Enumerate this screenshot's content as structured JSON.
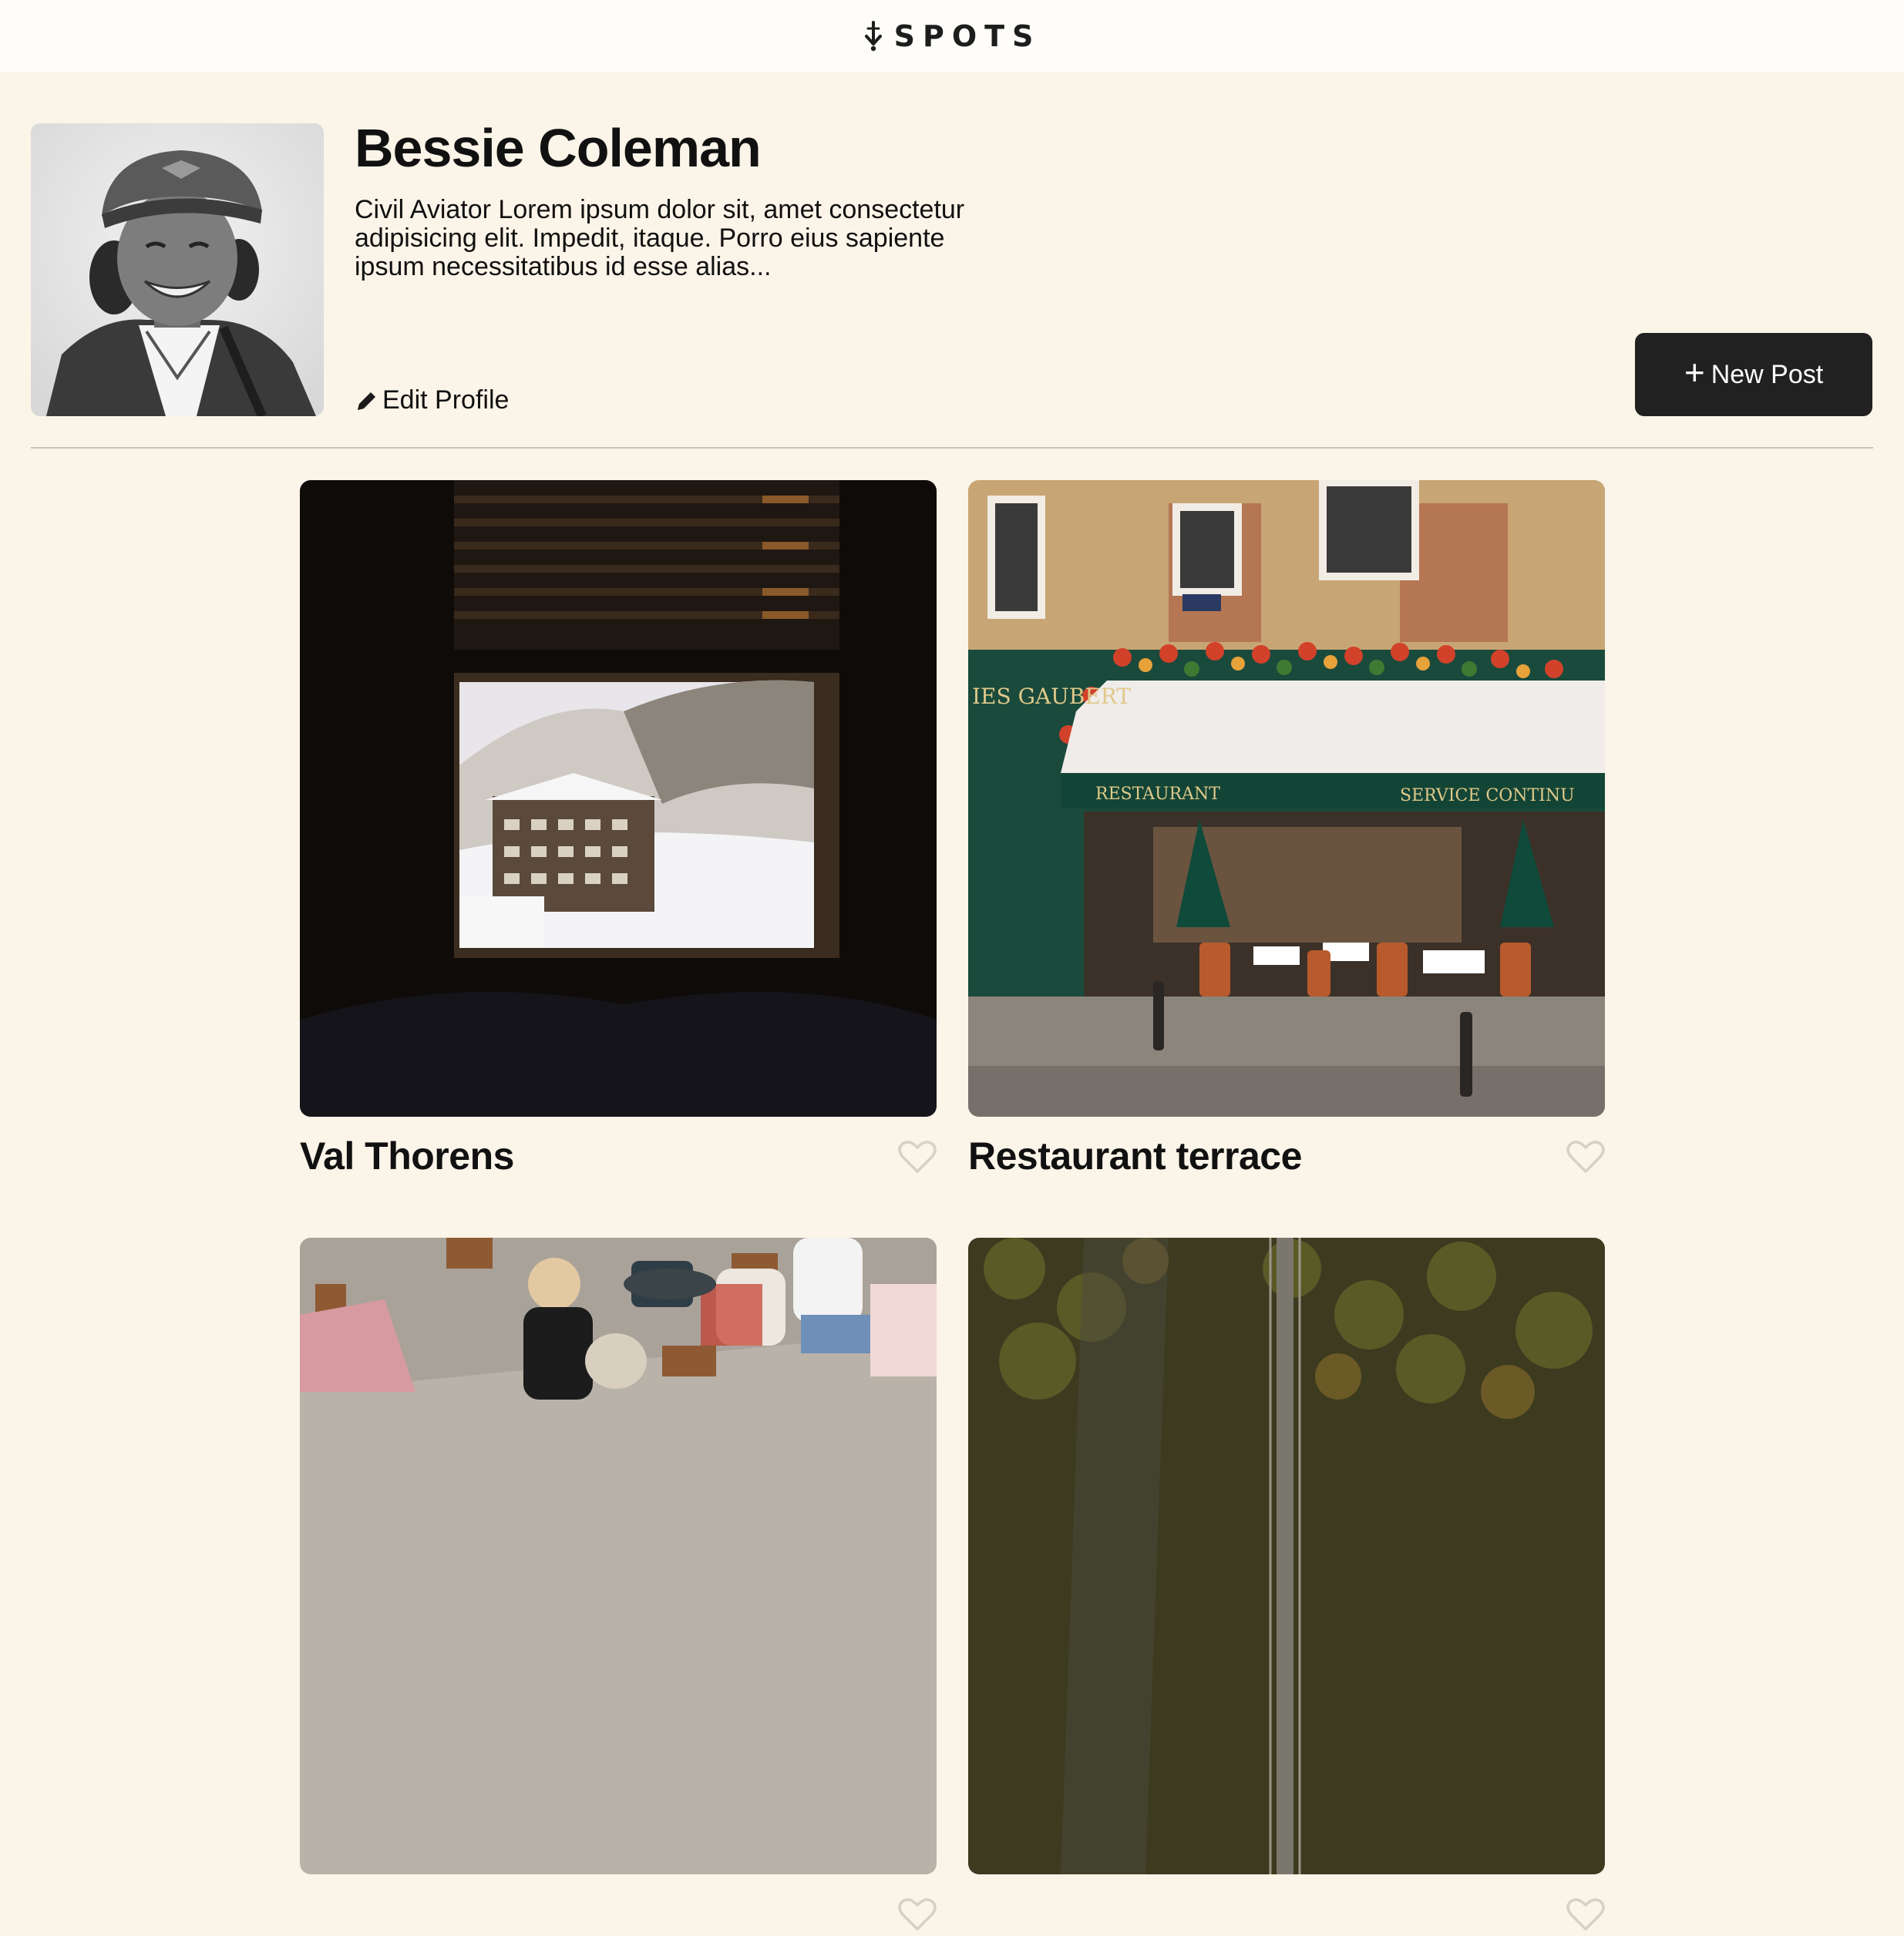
{
  "header": {
    "logo_text": "SPOTS",
    "logo_icon": "spots-logo-icon"
  },
  "profile": {
    "name": "Bessie Coleman",
    "description": "Civil Aviator Lorem ipsum dolor sit, amet consectetur adipisicing elit. Impedit, itaque. Porro eius sapiente ipsum necessitatibus id esse alias...",
    "edit_label": "Edit Profile",
    "edit_icon": "pencil-icon",
    "new_post_label": "New Post",
    "new_post_icon": "plus-icon"
  },
  "cards": [
    {
      "title": "Val Thorens",
      "liked": false,
      "like_icon": "heart-outline-icon"
    },
    {
      "title": "Restaurant terrace",
      "liked": false,
      "like_icon": "heart-outline-icon"
    },
    {
      "title": "",
      "liked": false,
      "like_icon": "heart-outline-icon"
    },
    {
      "title": "",
      "liked": false,
      "like_icon": "heart-outline-icon"
    }
  ],
  "colors": {
    "page_background": "#fbf4e8",
    "header_background": "#fffdf9",
    "button_background": "#212121",
    "text": "#111111",
    "heart_outline": "#d6d0c6"
  }
}
